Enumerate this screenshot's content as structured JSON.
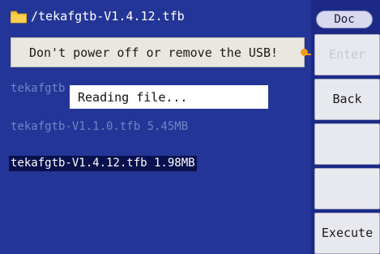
{
  "header": {
    "path": "/tekafgtb-V1.4.12.tfb",
    "folder_icon": "folder-icon"
  },
  "warning": {
    "text": "Don't power off or remove the USB!",
    "indicator_color": "#f49a19"
  },
  "files": [
    {
      "label": "tekafgtb"
    },
    {
      "label": "tekafgtb-V1.1.0.tfb  5.45MB"
    },
    {
      "label": "tekafgtb-V1.4.12.tfb  1.98MB",
      "selected": true
    }
  ],
  "dialog": {
    "text": "Reading file..."
  },
  "softkeys": {
    "tab": "Doc",
    "enter": "Enter",
    "back": "Back",
    "key3": "",
    "key4": "",
    "execute": "Execute"
  },
  "colors": {
    "panel_bg": "#233596",
    "selected_bg": "#08104d",
    "accent": "#f49a19"
  }
}
